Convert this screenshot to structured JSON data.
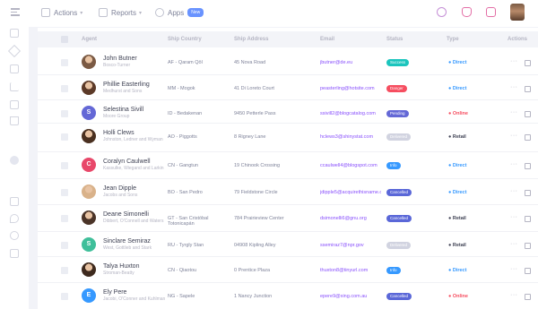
{
  "topbar": {
    "menu": [
      {
        "label": "Actions",
        "icon": "actions-icon",
        "has_dropdown": true
      },
      {
        "label": "Reports",
        "icon": "reports-icon",
        "has_dropdown": true
      },
      {
        "label": "Apps",
        "icon": "apps-icon",
        "badge": "New"
      }
    ],
    "right_icons": [
      "search-icon",
      "bell-icon",
      "gift-icon",
      "user-avatar"
    ]
  },
  "sidebar": {
    "icons": [
      "file-icon",
      "tools-icon",
      "calendar-icon",
      "chart-icon",
      "alert-icon",
      "warning-icon",
      "circle-icon",
      "document-icon",
      "drop-icon",
      "help-icon",
      "archive-icon"
    ]
  },
  "table": {
    "columns": [
      "Agent",
      "Ship Country",
      "Ship Address",
      "Email",
      "Status",
      "Type",
      "Actions"
    ],
    "rows": [
      {
        "name": "John Butner",
        "company": "Bosco-Turner",
        "avatar": "photo",
        "avatar_color": "#7b5a44",
        "country": "AF - Qaram Qōl",
        "address": "45 Nova Road",
        "email": "jbutner@de.eu",
        "status": "Success",
        "status_color": "#1bc5bd",
        "type": "Direct",
        "type_color": "#3699ff"
      },
      {
        "name": "Phillie Easterling",
        "company": "Medhurst and Sons",
        "avatar": "photo",
        "avatar_color": "#5c3a28",
        "country": "MM - Mogok",
        "address": "41 Di Loreto Court",
        "email": "peasterling@hotsite.com",
        "status": "Danger",
        "status_color": "#f64e60",
        "type": "Direct",
        "type_color": "#3699ff"
      },
      {
        "name": "Selestina Sivill",
        "company": "Moore Group",
        "avatar": "S",
        "avatar_color": "#6468d6",
        "country": "ID - Bedakenan",
        "address": "9450 Petterle Pass",
        "email": "ssivill2@blogcatalog.com",
        "status": "Pending",
        "status_color": "#6468d6",
        "type": "Online",
        "type_color": "#f64e60"
      },
      {
        "name": "Holli Clews",
        "company": "Johnston, Ledner and Wyman",
        "avatar": "photo",
        "avatar_color": "#4a3020",
        "country": "AO - Piggotts",
        "address": "8 Rigney Lane",
        "email": "hclews3@shinystat.com",
        "status": "Delivered",
        "status_color": "#d1d3e0",
        "type": "Retail",
        "type_color": "#3f4254"
      },
      {
        "name": "Coralyn Caulwell",
        "company": "Kassulke, Wiegand and Larkin",
        "avatar": "C",
        "avatar_color": "#e8486a",
        "country": "CN - Gangtun",
        "address": "19 Chinook Crossing",
        "email": "ccaulwell4@blogspot.com",
        "status": "Info",
        "status_color": "#3699ff",
        "type": "Direct",
        "type_color": "#3699ff"
      },
      {
        "name": "Jean Dipple",
        "company": "Jacobs and Sons",
        "avatar": "photo",
        "avatar_color": "#d9b28a",
        "country": "BO - San Pedro",
        "address": "79 Fieldstone Circle",
        "email": "jdipple5@acquirethisname.com",
        "status": "Cancelled",
        "status_color": "#5a67d8",
        "type": "Direct",
        "type_color": "#3699ff"
      },
      {
        "name": "Deane Simonelli",
        "company": "Dibbert, O'Connell and Waters",
        "avatar": "photo",
        "avatar_color": "#4b3428",
        "country": "GT - San Cristóbal Totonicapán",
        "address": "784 Prairieview Center",
        "email": "dsimonelli6@gnu.org",
        "status": "Cancelled",
        "status_color": "#5a67d8",
        "type": "Retail",
        "type_color": "#3f4254"
      },
      {
        "name": "Sinclare Semiraz",
        "company": "West, Gottlieb and Stark",
        "avatar": "S",
        "avatar_color": "#3fbf9a",
        "country": "RU - Tyrgly Stan",
        "address": "04908 Kipling Alley",
        "email": "ssemiraz7@npr.gov",
        "status": "Delivered",
        "status_color": "#d1d3e0",
        "type": "Retail",
        "type_color": "#3f4254"
      },
      {
        "name": "Talya Huxton",
        "company": "Stroman-Beatty",
        "avatar": "photo",
        "avatar_color": "#3e2a1e",
        "country": "CN - Qiaotou",
        "address": "0 Prentice Plaza",
        "email": "thuxton8@tinyurl.com",
        "status": "Info",
        "status_color": "#3699ff",
        "type": "Direct",
        "type_color": "#3699ff"
      },
      {
        "name": "Ely Pere",
        "company": "Jacobi, O'Conner and Kuhlman",
        "avatar": "E",
        "avatar_color": "#3699ff",
        "country": "NG - Sapele",
        "address": "1 Nancy Junction",
        "email": "epere9@xing.com.au",
        "status": "Cancelled",
        "status_color": "#5a67d8",
        "type": "Online",
        "type_color": "#f64e60"
      }
    ]
  }
}
